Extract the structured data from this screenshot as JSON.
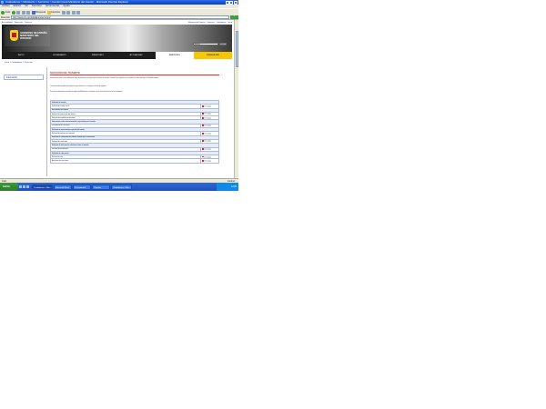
{
  "window": {
    "title": "Ciudadanos > Ministerio > Servicios > Gestión para Ministerio del Interior - Microsoft Internet Explorer"
  },
  "menubar": [
    "Archivo",
    "Edición",
    "Ver",
    "Favoritos",
    "Herramientas",
    "Ayuda"
  ],
  "toolbar": {
    "back_label": "Atrás",
    "search_label": "Búsqueda",
    "favorites_label": "Favoritos"
  },
  "address": {
    "label": "Dirección",
    "url": "http://www.mir.es/ciudadanos/servicios/",
    "go_label": "Ir"
  },
  "page": {
    "toplinks_left": [
      "Accesibilidad",
      "Mapa web",
      "Contacto"
    ],
    "toplinks_right": [
      "Ministerio del Interior",
      "Servicios",
      "Ciudadanos",
      "Inicio"
    ],
    "logo_text": "GOBIERNO DE ESPAÑA MINISTERIO DEL INTERIOR",
    "search_placeholder": "Buscar",
    "search_button": "Buscar",
    "nav": [
      {
        "label": "INICIO",
        "state": "normal"
      },
      {
        "label": "CIUDADANOS",
        "state": "normal"
      },
      {
        "label": "MINISTERIO",
        "state": "normal"
      },
      {
        "label": "ACTUALIDAD",
        "state": "normal"
      },
      {
        "label": "SERVICIOS",
        "state": "active"
      },
      {
        "label": "PRENSA MIR",
        "state": "highlight"
      }
    ],
    "breadcrumb": "Inicio > Ciudadanos > Servicios",
    "sidebar_item": "Informacion",
    "title": "SECCIÓN DE TRÁMITE",
    "intro_1": "Informacion sobre el procedimiento y documentacion necesaria para realizar el tramite. Consulte los requisitos y el estado de cada solicitud en el listado inferior.",
    "intro_2": "Los formularios pueden descargarse y presentarse en cualquier oficina de registro.",
    "intro_3": "Para mas informacion consulte la pagina del Ministerio o contacte con el servicio de atencion al ciudadano.",
    "table": [
      {
        "type": "section",
        "label": "Solicitud de tramite"
      },
      {
        "type": "row",
        "label": "Solicitud de tramite inicial",
        "status": "Descargar"
      },
      {
        "type": "section",
        "label": "Renovacion de tramite"
      },
      {
        "type": "row",
        "label": "Solicitud de renovacion del tramite",
        "status": "Descargar"
      },
      {
        "type": "row",
        "label": "Solicitud de modificacion de datos",
        "status": "Descargar"
      },
      {
        "type": "section",
        "label": "Informacion sobre documentacion requerida para el tramite"
      },
      {
        "type": "row",
        "label": "Documentacion necesaria",
        "status": "Descargar"
      },
      {
        "type": "section",
        "label": "Solicitud de autorizacion especial del tramite"
      },
      {
        "type": "row",
        "label": "Solicitud de autorizacion especial",
        "status": "Descargar"
      },
      {
        "type": "section",
        "label": "Solicitud de certificado de tramite emitido por el Ministerio"
      },
      {
        "type": "row",
        "label": "Solicitud de certificado",
        "status": "Descargar"
      },
      {
        "type": "section",
        "label": "Solicitud de informacion adicional sobre el tramite"
      },
      {
        "type": "row",
        "label": "Solicitud de informacion",
        "status": "Descargar"
      },
      {
        "type": "section",
        "label": "Solicitud de cita previa"
      },
      {
        "type": "row",
        "label": "Solicitud de cita",
        "status": "Descargar"
      },
      {
        "type": "row",
        "label": "Anulacion de cita previa",
        "status": "Descargar"
      }
    ]
  },
  "status": {
    "text": "Listo",
    "zone": "Internet"
  },
  "taskbar": {
    "start": "Inicio",
    "tasks": [
      "Ciudadanos > Min...",
      "Microsoft Word",
      "Documento1",
      "Carpeta",
      "Ciudadanos > Min..."
    ],
    "time": "12:00"
  }
}
